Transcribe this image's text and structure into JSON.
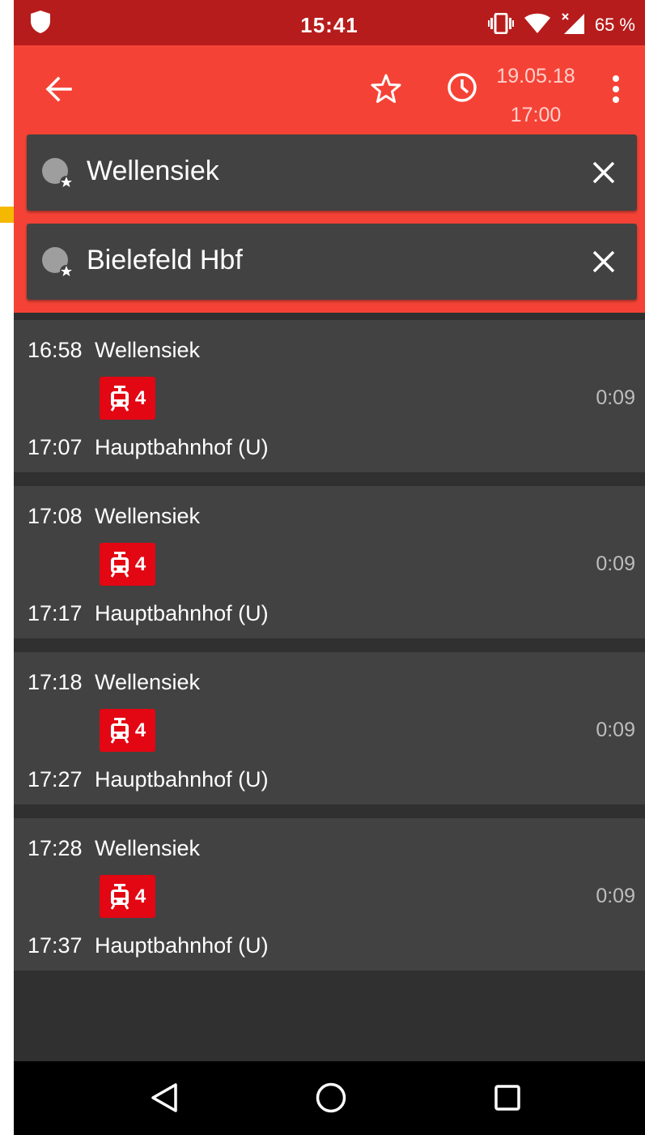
{
  "status_bar": {
    "time": "15:41",
    "battery": "65 %",
    "icons": [
      "shield-icon",
      "vibrate-icon",
      "wifi-icon",
      "signal-icon"
    ]
  },
  "app_bar": {
    "back_icon": "arrow-left-icon",
    "favorite_icon": "star-outline-icon",
    "time_icon": "clock-icon",
    "date": "19.05.18",
    "time": "17:00",
    "menu_icon": "more-vert-icon",
    "color": "#f44336"
  },
  "from": {
    "label": "Wellensiek",
    "clear_icon": "close-icon"
  },
  "to": {
    "label": "Bielefeld Hbf",
    "clear_icon": "close-icon"
  },
  "trips": [
    {
      "dep_time": "16:58",
      "dep_stop": "Wellensiek",
      "line": "4",
      "duration": "0:09",
      "arr_time": "17:07",
      "arr_stop": "Hauptbahnhof (U)"
    },
    {
      "dep_time": "17:08",
      "dep_stop": "Wellensiek",
      "line": "4",
      "duration": "0:09",
      "arr_time": "17:17",
      "arr_stop": "Hauptbahnhof (U)"
    },
    {
      "dep_time": "17:18",
      "dep_stop": "Wellensiek",
      "line": "4",
      "duration": "0:09",
      "arr_time": "17:27",
      "arr_stop": "Hauptbahnhof (U)"
    },
    {
      "dep_time": "17:28",
      "dep_stop": "Wellensiek",
      "line": "4",
      "duration": "0:09",
      "arr_time": "17:37",
      "arr_stop": "Hauptbahnhof (U)"
    }
  ],
  "line_color": "#e30613",
  "nav_bar": {
    "icons": [
      "nav-back-icon",
      "nav-home-icon",
      "nav-recent-icon"
    ]
  }
}
